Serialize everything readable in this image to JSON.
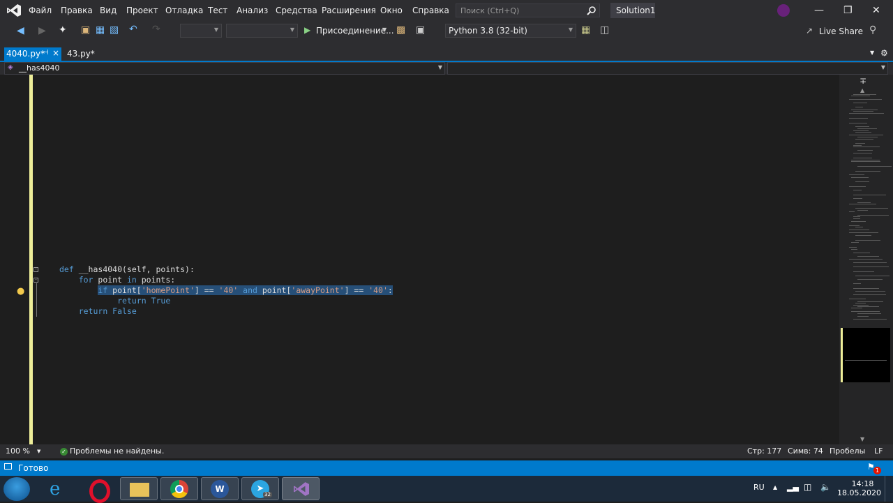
{
  "menu": {
    "items": [
      "Файл",
      "Правка",
      "Вид",
      "Проект",
      "Отладка",
      "Тест",
      "Анализ",
      "Средства",
      "Расширения",
      "Окно",
      "Справка"
    ],
    "search_placeholder": "Поиск (Ctrl+Q)",
    "solution": "Solution1"
  },
  "toolbar": {
    "attach_label": "Присоединение...",
    "python_env": "Python 3.8 (32-bit)",
    "live_share": "Live Share"
  },
  "tabs": [
    {
      "label": "4040.py*",
      "active": true
    },
    {
      "label": "43.py*",
      "active": false
    }
  ],
  "navbar": {
    "left": "__has4040",
    "right": ""
  },
  "code": {
    "line1_kw": "def",
    "line1_rest": " __has4040(self, points):",
    "line2_kw1": "for",
    "line2_mid": " point ",
    "line2_kw2": "in",
    "line2_rest": " points:",
    "line3_kw": "if",
    "line3_a": " point[",
    "line3_s1": "'homePoint'",
    "line3_b": "] == ",
    "line3_s2": "'40'",
    "line3_and": "and",
    "line3_c": " point[",
    "line3_s3": "'awayPoint'",
    "line3_d": "] == ",
    "line3_s4": "'40'",
    "line3_e": ":",
    "line4_kw": "return",
    "line4_val": " True",
    "line5_kw": "return",
    "line5_val": " False"
  },
  "editor_status": {
    "zoom": "100 %",
    "issues": "Проблемы не найдены.",
    "line": "Стр: 177",
    "col": "Симв: 74",
    "whitespace": "Пробелы",
    "eol": "LF"
  },
  "statusbar": {
    "text": "Готово",
    "notifications": "1"
  },
  "taskbar": {
    "lang": "RU",
    "time": "14:18",
    "date": "18.05.2020",
    "telegram_badge": "32"
  },
  "colors": {
    "accent": "#007acc",
    "change_marker": "#eeee99",
    "keyword": "#569cd6",
    "string": "#d69d85"
  }
}
